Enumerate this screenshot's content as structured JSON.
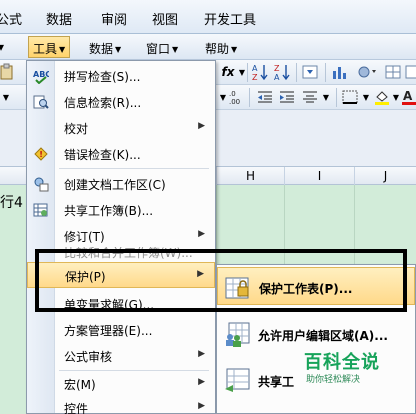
{
  "ribbon_tabs": [
    "公式",
    "数据",
    "审阅",
    "视图",
    "开发工具"
  ],
  "menubar": {
    "tools": "工具",
    "data": "数据",
    "window": "窗口",
    "help": "帮助"
  },
  "toolbar": {
    "function_label": "fx",
    "sort_label": "A↓Z"
  },
  "sheet": {
    "columns": [
      "H",
      "I",
      "J"
    ],
    "cell_text": "行4"
  },
  "tools_menu": {
    "items": [
      {
        "label": "拼写检查(S)...",
        "icon": "spell-check-icon"
      },
      {
        "label": "信息检索(R)...",
        "icon": "research-icon"
      },
      {
        "label": "校对",
        "icon": "",
        "submenu": true
      },
      {
        "label": "错误检查(K)...",
        "icon": "error-check-icon"
      },
      {
        "label": "创建文档工作区(C)",
        "icon": "document-workspace-icon"
      },
      {
        "label": "共享工作簿(B)...",
        "icon": "share-workbook-icon"
      },
      {
        "label": "修订(T)",
        "icon": "",
        "submenu": true
      },
      {
        "label": "比较和合并工作簿(W)...",
        "icon": "",
        "disabled": true
      },
      {
        "label": "保护(P)",
        "icon": "",
        "submenu": true,
        "highlighted": true
      },
      {
        "label": "单变量求解(G)...",
        "icon": ""
      },
      {
        "label": "方案管理器(E)...",
        "icon": ""
      },
      {
        "label": "公式审核",
        "icon": "",
        "submenu": true
      },
      {
        "label": "宏(M)",
        "icon": "",
        "submenu": true
      },
      {
        "label": "控件",
        "icon": "",
        "submenu": true
      }
    ]
  },
  "protect_submenu": {
    "items": [
      {
        "label": "保护工作表(P)...",
        "icon": "protect-sheet-icon",
        "highlighted": true
      },
      {
        "label": "允许用户编辑区域(A)...",
        "icon": "allow-edit-ranges-icon"
      },
      {
        "label": "共享工",
        "icon": "protect-shared-workbook-icon"
      }
    ]
  },
  "watermark": {
    "title": "百科全说",
    "subtitle": "助你轻松解决"
  },
  "colors": {
    "grid_fill": "#d2ecd9",
    "menu_highlight": "#ffd98a",
    "watermark_green": "#17a35a"
  }
}
